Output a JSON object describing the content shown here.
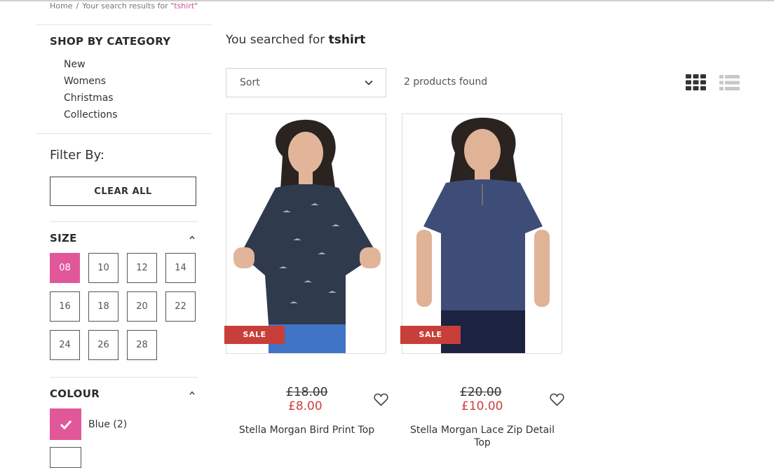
{
  "breadcrumb": {
    "home": "Home",
    "separator": "/",
    "prefix": "Your search results for \"",
    "term": "tshirt",
    "suffix": "\""
  },
  "sidebar": {
    "shop_by_category": "SHOP BY CATEGORY",
    "categories": [
      "New",
      "Womens",
      "Christmas",
      "Collections"
    ],
    "filter_by": "Filter By:",
    "clear_all": "CLEAR ALL",
    "size": {
      "title": "SIZE",
      "options": [
        "08",
        "10",
        "12",
        "14",
        "16",
        "18",
        "20",
        "22",
        "24",
        "26",
        "28"
      ],
      "selected": "08"
    },
    "colour": {
      "title": "COLOUR",
      "options": [
        {
          "label": "Blue (2)",
          "checked": true
        }
      ]
    }
  },
  "main": {
    "searched_prefix": "You searched for ",
    "searched_term": "tshirt",
    "sort_label": "Sort",
    "products_found": "2 products found"
  },
  "products": [
    {
      "name": "Stella Morgan Bird Print Top",
      "old_price": "£18.00",
      "new_price": "£8.00",
      "badge": "SALE",
      "top_color": "#2f3a4c"
    },
    {
      "name": "Stella Morgan Lace Zip Detail Top",
      "old_price": "£20.00",
      "new_price": "£10.00",
      "badge": "SALE",
      "top_color": "#3e4d78"
    }
  ],
  "colors": {
    "accent_pink": "#e0589a",
    "sale_red": "#c83f3a",
    "price_red": "#cf3d3d"
  }
}
